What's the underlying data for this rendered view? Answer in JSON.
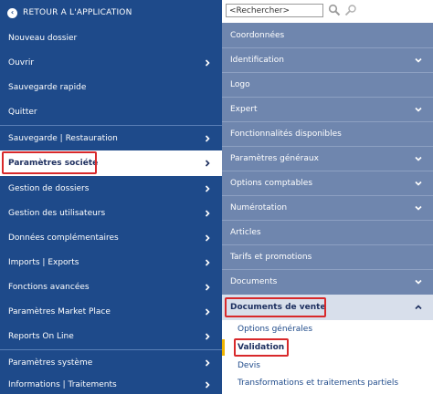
{
  "back": {
    "label": "RETOUR A L'APPLICATION",
    "icon": "arrow-left-circle-icon"
  },
  "left_menu": {
    "items": [
      {
        "label": "Nouveau dossier",
        "has_chevron": false
      },
      {
        "label": "Ouvrir",
        "has_chevron": true
      },
      {
        "label": "Sauvegarde rapide",
        "has_chevron": false
      },
      {
        "label": "Quitter",
        "has_chevron": false
      },
      {
        "label": "Sauvegarde | Restauration",
        "has_chevron": true
      },
      {
        "label": "Paramètres société",
        "has_chevron": true,
        "active": true
      },
      {
        "label": "Gestion de dossiers",
        "has_chevron": true
      },
      {
        "label": "Gestion des utilisateurs",
        "has_chevron": true
      },
      {
        "label": "Données complémentaires",
        "has_chevron": true
      },
      {
        "label": "Imports | Exports",
        "has_chevron": true
      },
      {
        "label": "Fonctions avancées",
        "has_chevron": true
      },
      {
        "label": "Paramètres Market Place",
        "has_chevron": true
      },
      {
        "label": "Reports On Line",
        "has_chevron": true
      },
      {
        "label": "Paramètres système",
        "has_chevron": true
      },
      {
        "label": "Informations | Traitements",
        "has_chevron": true
      }
    ]
  },
  "search": {
    "placeholder": "<Rechercher>",
    "value": ""
  },
  "right_panel": {
    "items": [
      {
        "label": "Coordonnées",
        "has_chevron": false
      },
      {
        "label": "Identification",
        "has_chevron": true
      },
      {
        "label": "Logo",
        "has_chevron": false
      },
      {
        "label": "Expert",
        "has_chevron": true
      },
      {
        "label": "Fonctionnalités disponibles",
        "has_chevron": false
      },
      {
        "label": "Paramètres généraux",
        "has_chevron": true
      },
      {
        "label": "Options comptables",
        "has_chevron": true
      },
      {
        "label": "Numérotation",
        "has_chevron": true
      },
      {
        "label": "Articles",
        "has_chevron": false
      },
      {
        "label": "Tarifs et promotions",
        "has_chevron": false
      },
      {
        "label": "Documents",
        "has_chevron": true
      }
    ],
    "open_section": {
      "label": "Documents de vente",
      "sub_items": [
        {
          "label": "Options générales"
        },
        {
          "label": "Validation",
          "active": true
        },
        {
          "label": "Devis"
        },
        {
          "label": "Transformations et traitements partiels"
        }
      ]
    }
  },
  "colors": {
    "left_menu_bg": "#1e4a8a",
    "right_list_bg": "#6f86ae",
    "highlight_border": "#d8292b",
    "active_marker": "#f0b400"
  }
}
